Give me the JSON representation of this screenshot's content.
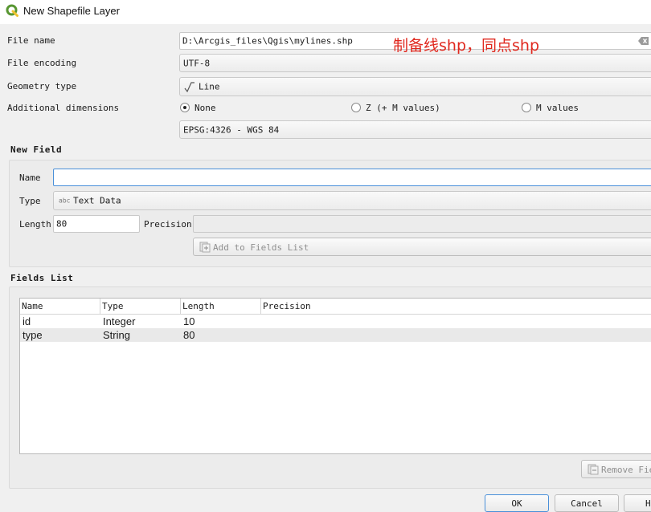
{
  "window": {
    "title": "New Shapefile Layer"
  },
  "form": {
    "file_name_label": "File name",
    "file_name_value": "D:\\Arcgis_files\\Qgis\\mylines.shp",
    "file_encoding_label": "File encoding",
    "file_encoding_value": "UTF-8",
    "geometry_type_label": "Geometry type",
    "geometry_type_value": "Line",
    "dimensions_label": "Additional dimensions",
    "dim_none": "None",
    "dim_z": "Z (+ M values)",
    "dim_m": "M values",
    "dim_selected": "None",
    "crs_value": "EPSG:4326 - WGS 84"
  },
  "annotation": "制备线shp，同点shp",
  "new_field": {
    "section_title": "New Field",
    "name_label": "Name",
    "name_value": "",
    "type_label": "Type",
    "type_icon_text": "abc",
    "type_value": "Text Data",
    "length_label": "Length",
    "length_value": "80",
    "precision_label": "Precision",
    "precision_value": "",
    "add_button": "Add to Fields List"
  },
  "fields_list": {
    "section_title": "Fields List",
    "columns": [
      "Name",
      "Type",
      "Length",
      "Precision"
    ],
    "rows": [
      {
        "name": "id",
        "type": "Integer",
        "length": "10",
        "precision": ""
      },
      {
        "name": "type",
        "type": "String",
        "length": "80",
        "precision": ""
      }
    ],
    "remove_button": "Remove Fiel"
  },
  "buttons": {
    "ok": "OK",
    "cancel": "Cancel",
    "help": "H"
  }
}
